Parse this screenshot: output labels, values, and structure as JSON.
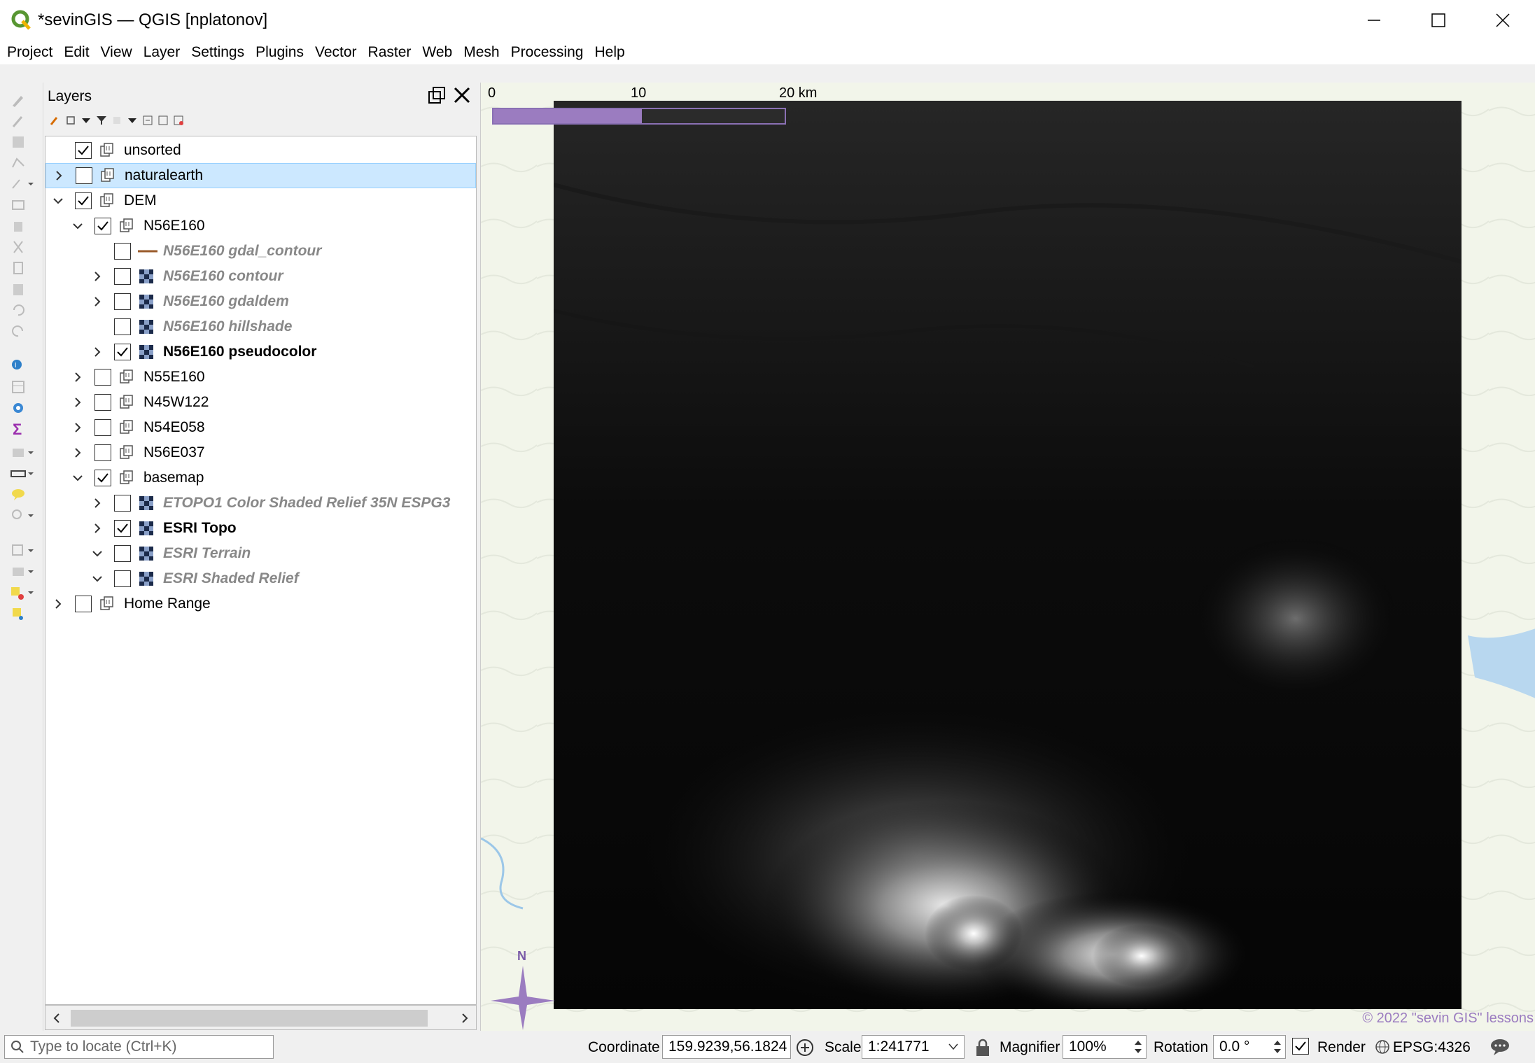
{
  "window": {
    "title": "*sevinGIS — QGIS [nplatonov]"
  },
  "menu": [
    "Project",
    "Edit",
    "View",
    "Layer",
    "Settings",
    "Plugins",
    "Vector",
    "Raster",
    "Web",
    "Mesh",
    "Processing",
    "Help"
  ],
  "layers_panel": {
    "title": "Layers",
    "tree": [
      {
        "label": "unsorted",
        "checked": true,
        "expander": "none",
        "type": "group",
        "style": "normal"
      },
      {
        "label": "naturalearth",
        "checked": false,
        "expander": "collapsed",
        "type": "group",
        "style": "normal",
        "selected": true
      },
      {
        "label": "DEM",
        "checked": true,
        "expander": "expanded",
        "type": "group",
        "style": "normal"
      },
      {
        "label": "N56E160",
        "checked": true,
        "expander": "expanded",
        "type": "group",
        "style": "normal"
      },
      {
        "label": "N56E160 gdal_contour",
        "checked": false,
        "expander": "none",
        "type": "line",
        "style": "italic"
      },
      {
        "label": "N56E160 contour",
        "checked": false,
        "expander": "collapsed",
        "type": "raster",
        "style": "italic"
      },
      {
        "label": "N56E160 gdaldem",
        "checked": false,
        "expander": "collapsed",
        "type": "raster",
        "style": "italic"
      },
      {
        "label": "N56E160 hillshade",
        "checked": false,
        "expander": "none",
        "type": "raster",
        "style": "italic"
      },
      {
        "label": "N56E160 pseudocolor",
        "checked": true,
        "expander": "collapsed",
        "type": "raster",
        "style": "bold"
      },
      {
        "label": "N55E160",
        "checked": false,
        "expander": "collapsed",
        "type": "group",
        "style": "normal"
      },
      {
        "label": "N45W122",
        "checked": false,
        "expander": "collapsed",
        "type": "group",
        "style": "normal"
      },
      {
        "label": "N54E058",
        "checked": false,
        "expander": "collapsed",
        "type": "group",
        "style": "normal"
      },
      {
        "label": "N56E037",
        "checked": false,
        "expander": "collapsed",
        "type": "group",
        "style": "normal"
      },
      {
        "label": "basemap",
        "checked": true,
        "expander": "expanded",
        "type": "group",
        "style": "normal"
      },
      {
        "label": "ETOPO1 Color Shaded Relief 35N ESPG3",
        "checked": false,
        "expander": "collapsed",
        "type": "raster",
        "style": "italic"
      },
      {
        "label": "ESRI Topo",
        "checked": true,
        "expander": "collapsed",
        "type": "raster",
        "style": "bold"
      },
      {
        "label": "ESRI Terrain",
        "checked": false,
        "expander": "expanded",
        "type": "raster",
        "style": "italic"
      },
      {
        "label": "ESRI Shaded Relief",
        "checked": false,
        "expander": "expanded",
        "type": "raster",
        "style": "italic"
      },
      {
        "label": "Home Range",
        "checked": false,
        "expander": "collapsed",
        "type": "group",
        "style": "normal"
      }
    ]
  },
  "map": {
    "scalebar": {
      "label_0": "0",
      "label_10": "10",
      "label_20": "20 km"
    },
    "north_label": "N",
    "copyright": "© 2022 \"sevin GIS\" lessons"
  },
  "statusbar": {
    "locate_placeholder": "Type to locate (Ctrl+K)",
    "coordinate_label": "Coordinate",
    "coordinate_value": "159.9239,56.1824",
    "scale_label": "Scale",
    "scale_value": "1:241771",
    "magnifier_label": "Magnifier",
    "magnifier_value": "100%",
    "rotation_label": "Rotation",
    "rotation_value": "0.0 °",
    "render_label": "Render",
    "render_checked": true,
    "crs": "EPSG:4326"
  },
  "colors": {
    "selection": "#cce8ff",
    "scalebar": "#9b7cc0",
    "copyright": "#9b7cc0"
  }
}
